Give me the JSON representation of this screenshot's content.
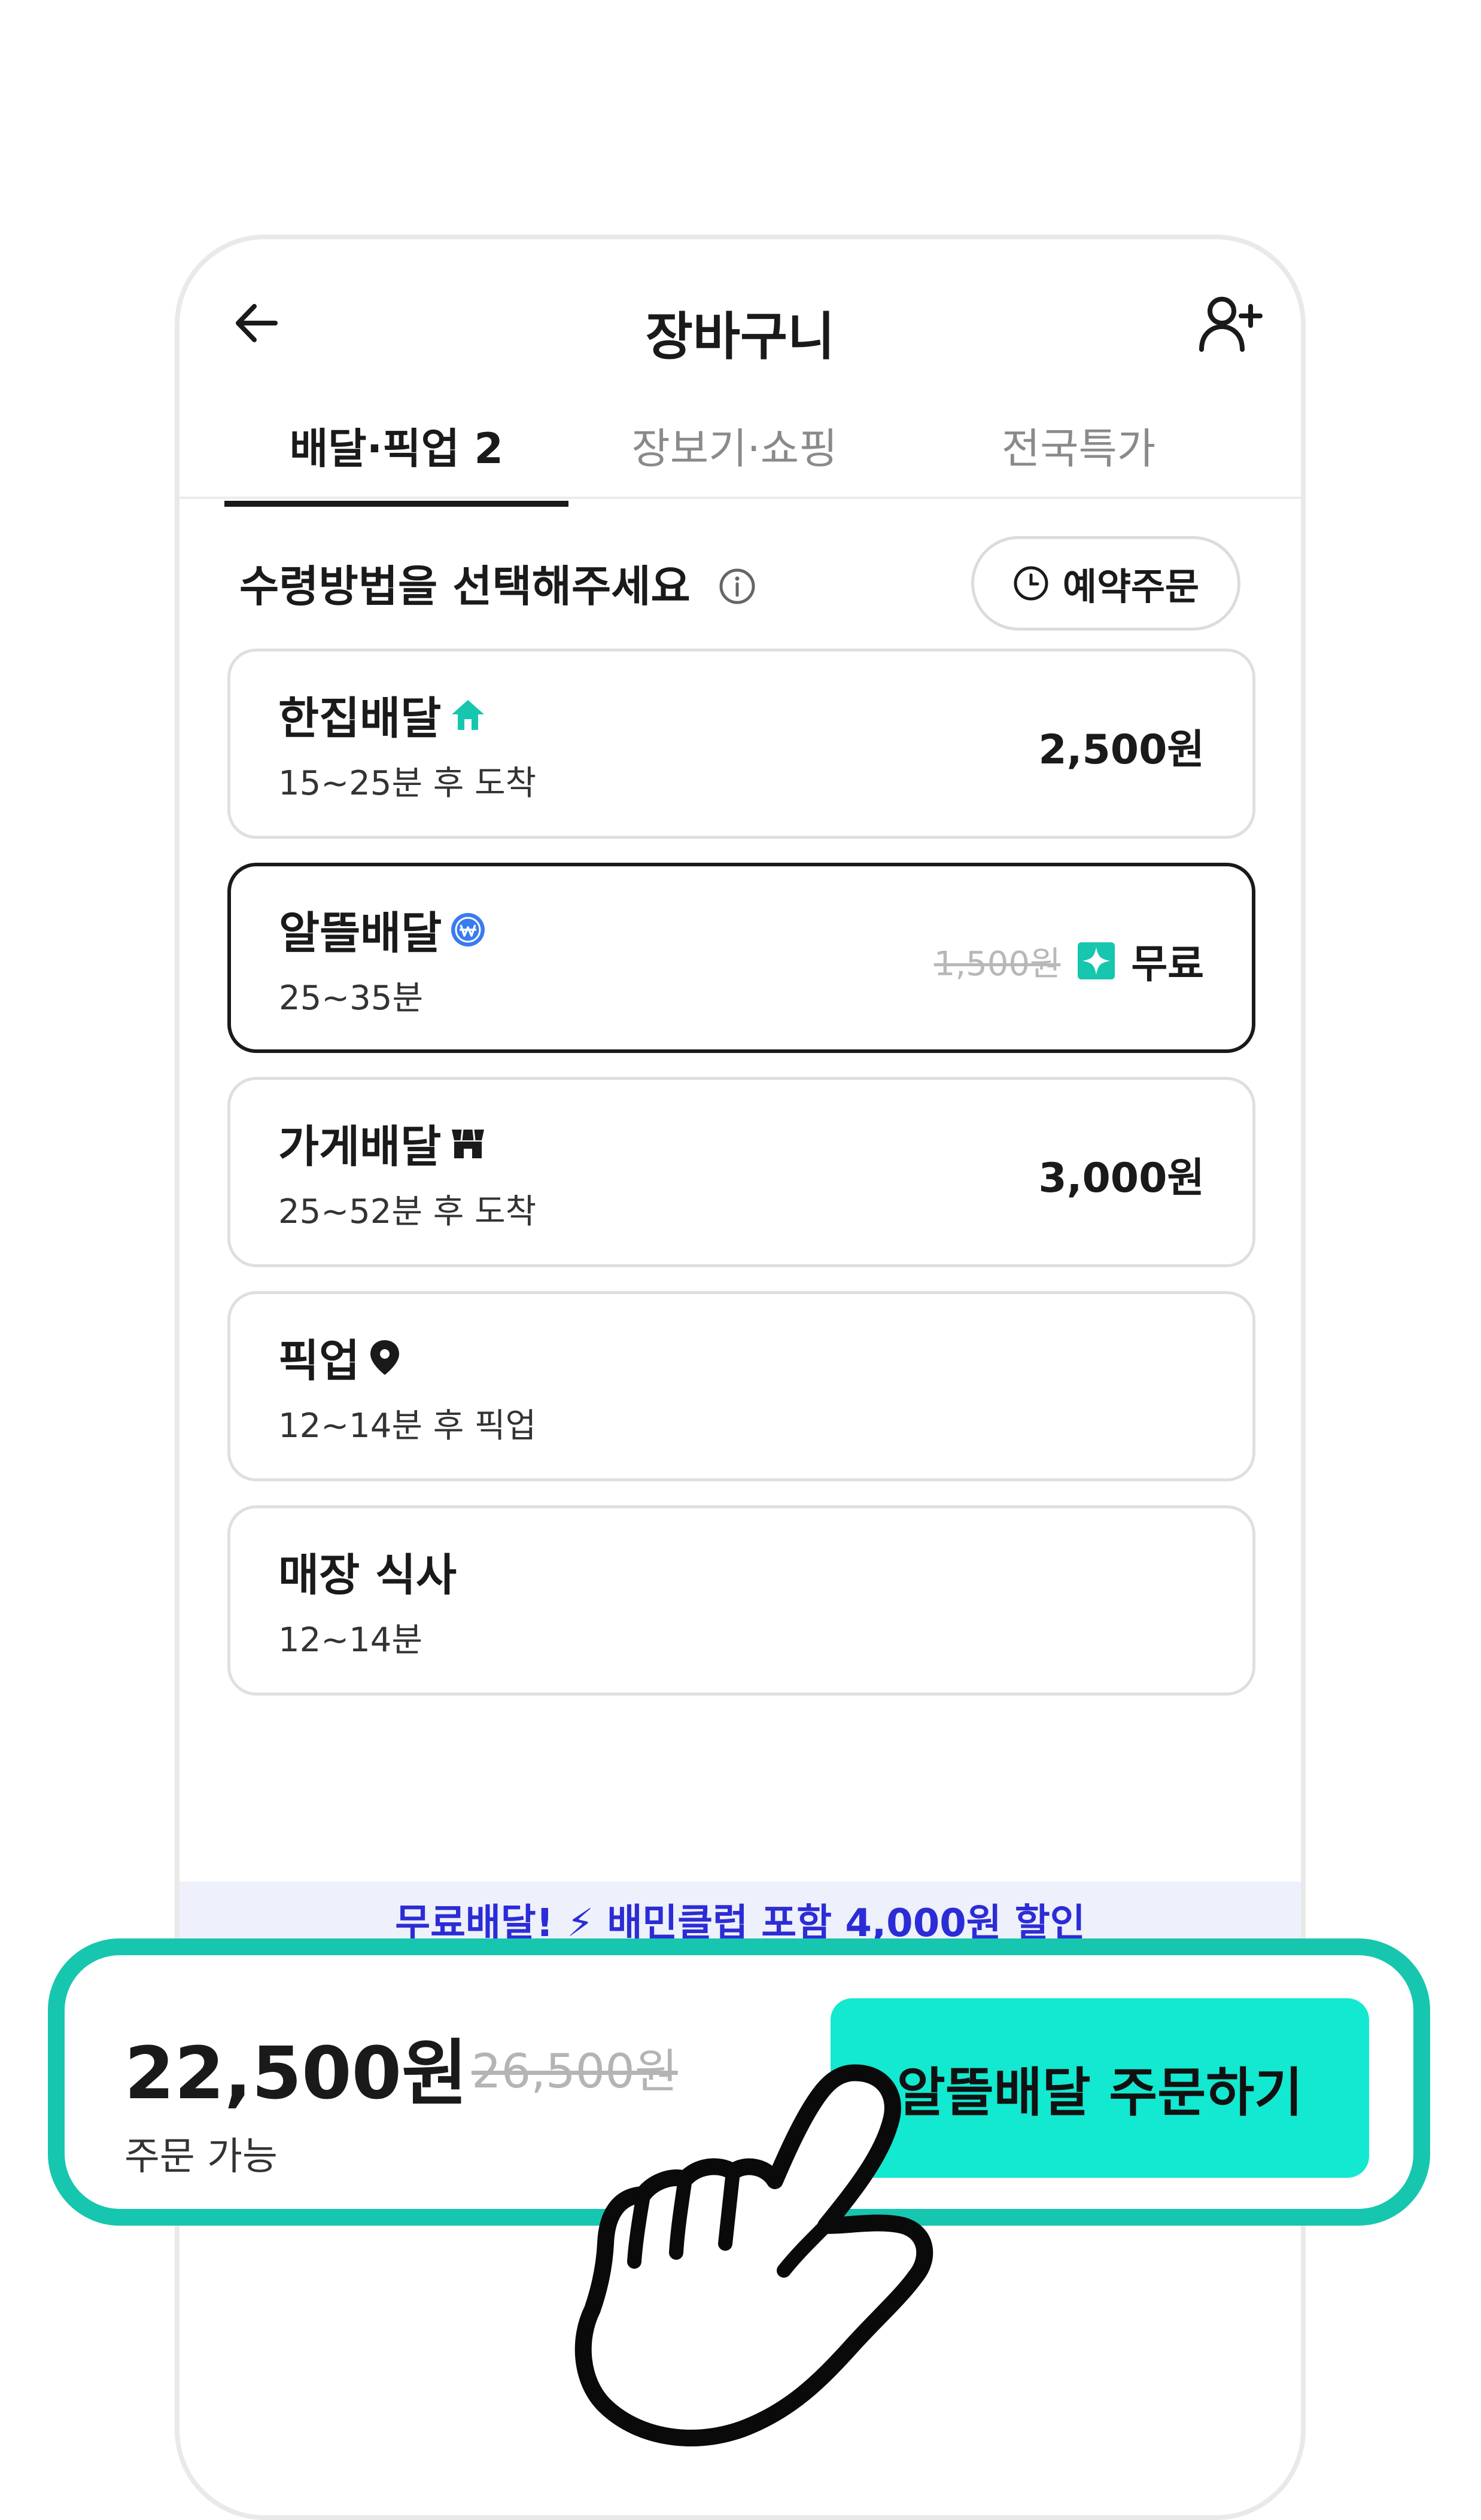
{
  "header": {
    "title": "장바구니"
  },
  "tabs": [
    {
      "label": "배달·픽업 2",
      "active": true
    },
    {
      "label": "장보기·쇼핑",
      "active": false
    },
    {
      "label": "전국특가",
      "active": false
    }
  ],
  "section": {
    "title": "수령방법을 선택해주세요",
    "reserve_label": "예약주문"
  },
  "options": [
    {
      "name": "한집배달",
      "time": "15~25분 후 도착",
      "price": "2,500원",
      "icon": "house-icon",
      "selected": false
    },
    {
      "name": "알뜰배달",
      "time": "25~35분",
      "original_price": "1,500원",
      "price": "무료",
      "icon": "won-coin-icon",
      "selected": true
    },
    {
      "name": "가게배달",
      "time": "25~52분 후 도착",
      "price": "3,000원",
      "icon": "store-icon",
      "selected": false
    },
    {
      "name": "픽업",
      "time": "12~14분 후 픽업",
      "price": "",
      "icon": "location-pin-icon",
      "selected": false
    },
    {
      "name": "매장 식사",
      "time": "12~14분",
      "price": "",
      "icon": "",
      "selected": false
    }
  ],
  "promo": {
    "text": "무료배달! ⚡ 배민클럽 포함 4,000원 할인"
  },
  "order": {
    "total": "22,500원",
    "original_total": "26,500원",
    "status": "주문 가능",
    "button_label": "알뜰배달 주문하기"
  },
  "colors": {
    "accent": "#13e8d0",
    "frame": "#17c6ae",
    "promo_text": "#2c2cd6"
  }
}
